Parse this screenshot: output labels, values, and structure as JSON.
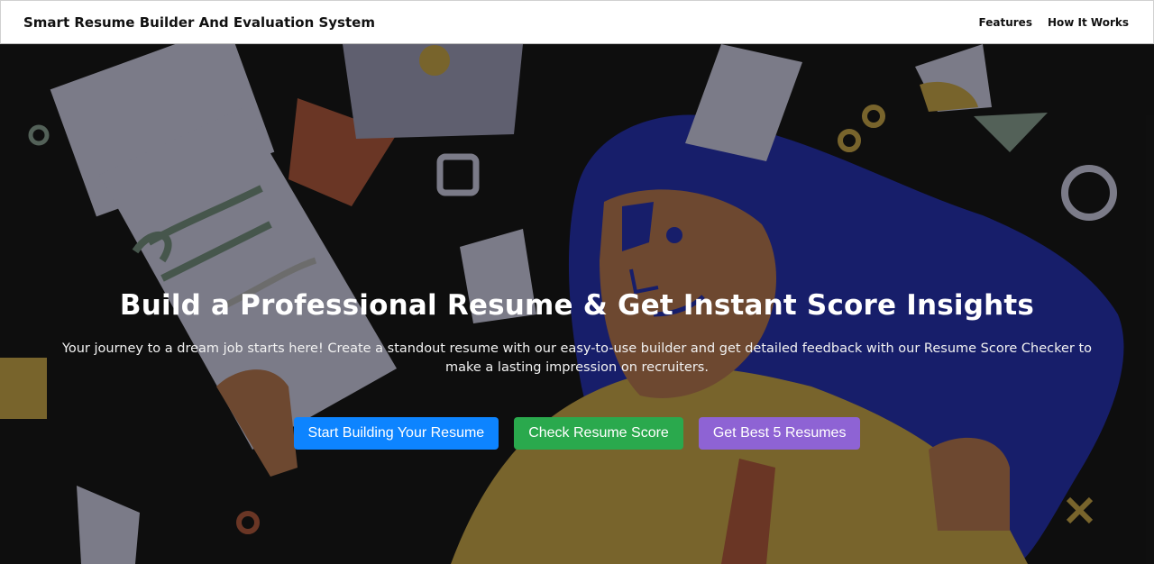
{
  "navbar": {
    "brand": "Smart Resume Builder And Evaluation System",
    "links": [
      "Features",
      "How It Works"
    ]
  },
  "hero": {
    "title": "Build a Professional Resume & Get Instant Score Insights",
    "subtitle": "Your journey to a dream job starts here! Create a standout resume with our easy-to-use builder and get detailed feedback with our Resume Score Checker to make a lasting impression on recruiters.",
    "buttons": {
      "build": "Start Building Your Resume",
      "score": "Check Resume Score",
      "best": "Get Best 5 Resumes"
    }
  },
  "colors": {
    "primary": "#0d84ff",
    "success": "#2aa94d",
    "purple": "#8e63d4",
    "background": "#111111"
  }
}
